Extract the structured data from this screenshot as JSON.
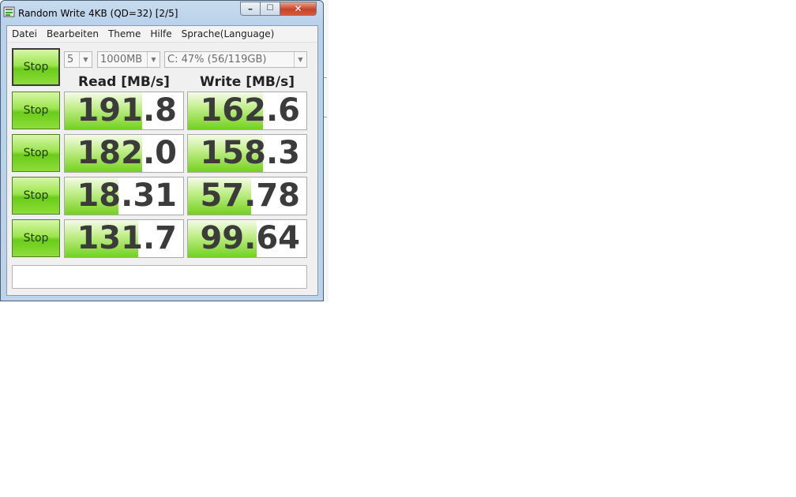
{
  "window": {
    "title": "Random Write 4KB (QD=32) [2/5]"
  },
  "menu": [
    "Datei",
    "Bearbeiten",
    "Theme",
    "Hilfe",
    "Sprache(Language)"
  ],
  "controls": {
    "all_button": "Stop",
    "count": "5",
    "size": "1000MB",
    "drive": "C: 47% (56/119GB)"
  },
  "headers": {
    "read": "Read [MB/s]",
    "write": "Write [MB/s]"
  },
  "rows": [
    {
      "button": "Stop",
      "read": "191.8",
      "write": "162.6",
      "read_fill": 0.65,
      "write_fill": 0.63
    },
    {
      "button": "Stop",
      "read": "182.0",
      "write": "158.3",
      "read_fill": 0.65,
      "write_fill": 0.63
    },
    {
      "button": "Stop",
      "read": "18.31",
      "write": "57.78",
      "read_fill": 0.45,
      "write_fill": 0.53
    },
    {
      "button": "Stop",
      "read": "131.7",
      "write": "99.64",
      "read_fill": 0.62,
      "write_fill": 0.58
    }
  ],
  "status_text": ""
}
